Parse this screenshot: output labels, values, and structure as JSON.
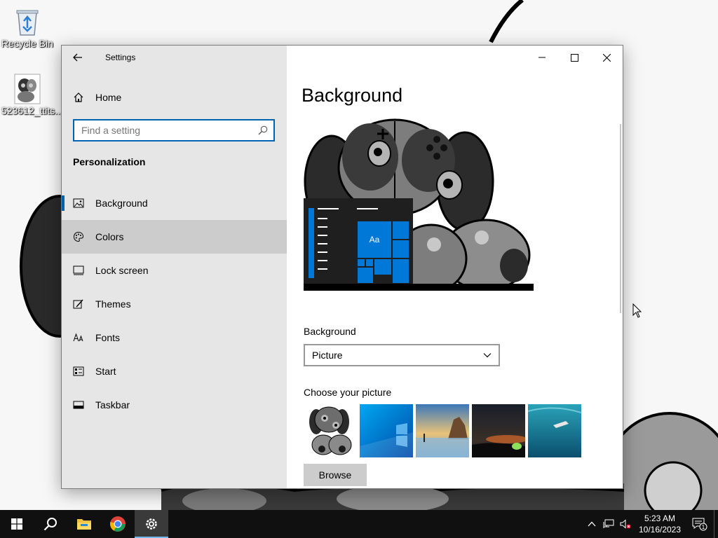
{
  "desktop": {
    "icons": [
      {
        "label": "Recycle Bin",
        "icon": "recycle-bin-icon"
      },
      {
        "label": "523612_ttits...",
        "icon": "image-file-icon"
      }
    ]
  },
  "window": {
    "title": "Settings",
    "caption_buttons": [
      "minimize-icon",
      "maximize-icon",
      "close-icon"
    ]
  },
  "nav": {
    "home_label": "Home",
    "search_placeholder": "Find a setting",
    "section_title": "Personalization",
    "items": [
      {
        "label": "Background",
        "icon": "picture-icon",
        "state": "selected"
      },
      {
        "label": "Colors",
        "icon": "palette-icon",
        "state": "hover"
      },
      {
        "label": "Lock screen",
        "icon": "lock-screen-icon",
        "state": ""
      },
      {
        "label": "Themes",
        "icon": "themes-icon",
        "state": ""
      },
      {
        "label": "Fonts",
        "icon": "fonts-icon",
        "state": ""
      },
      {
        "label": "Start",
        "icon": "start-icon",
        "state": ""
      },
      {
        "label": "Taskbar",
        "icon": "taskbar-icon",
        "state": ""
      }
    ]
  },
  "content": {
    "page_title": "Background",
    "preview_tile_text": "Aa",
    "background_label": "Background",
    "background_value": "Picture",
    "choose_label": "Choose your picture",
    "browse_label": "Browse"
  },
  "taskbar": {
    "apps": [
      "start-icon",
      "search-icon",
      "file-explorer-icon",
      "chrome-icon",
      "settings-icon"
    ],
    "active_app": "settings-icon",
    "time": "5:23 AM",
    "date": "10/16/2023",
    "notification_count": "1"
  },
  "colors": {
    "accent": "#0078d7",
    "nav_bg": "#e6e6e6",
    "hover": "#cccccc",
    "taskbar": "#101010"
  }
}
